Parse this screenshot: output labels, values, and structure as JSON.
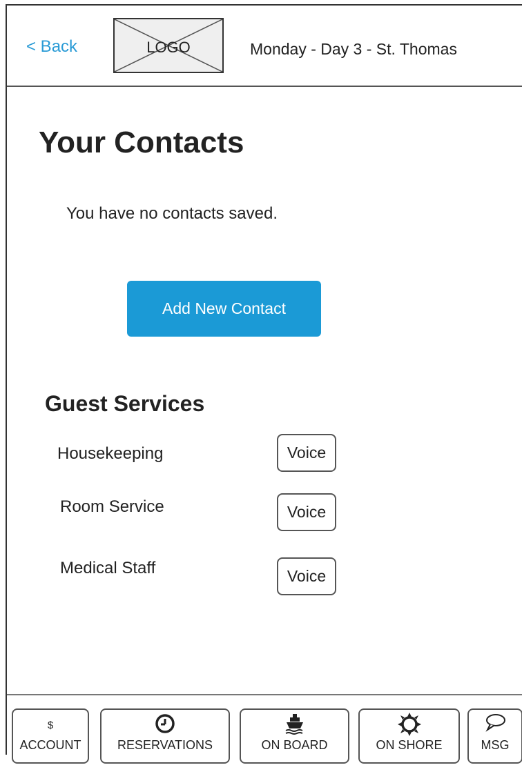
{
  "header": {
    "back_label": "< Back",
    "logo_text": "LOGO",
    "title": "Monday - Day 3 - St. Thomas"
  },
  "main": {
    "page_title": "Your Contacts",
    "empty_message": "You have no contacts saved.",
    "add_contact_label": "Add New Contact"
  },
  "guest_services": {
    "title": "Guest Services",
    "items": [
      {
        "label": "Housekeeping",
        "action": "Voice"
      },
      {
        "label": "Room Service",
        "action": "Voice"
      },
      {
        "label": "Medical Staff",
        "action": "Voice"
      }
    ]
  },
  "bottom_nav": {
    "tabs": [
      {
        "label": "ACCOUNT",
        "icon": "dollar-icon",
        "icon_text": "$"
      },
      {
        "label": "RESERVATIONS",
        "icon": "clock-icon"
      },
      {
        "label": "ON BOARD",
        "icon": "ship-icon"
      },
      {
        "label": "ON SHORE",
        "icon": "sun-icon"
      },
      {
        "label": "MSG",
        "icon": "speech-bubble-icon"
      }
    ]
  },
  "colors": {
    "accent": "#1b9ad6",
    "link": "#2a9bd6"
  }
}
